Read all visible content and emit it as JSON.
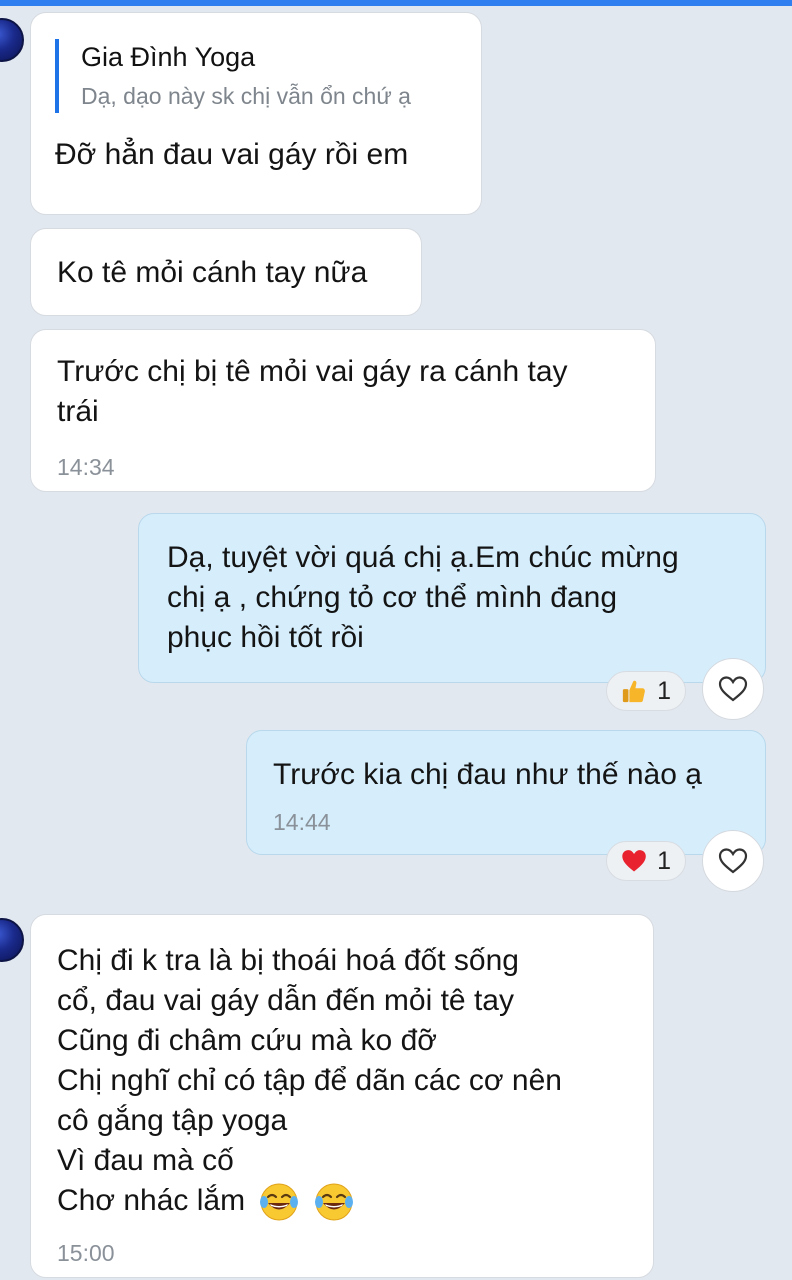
{
  "messages": [
    {
      "id": "m1",
      "direction": "incoming",
      "reply_to": {
        "name": "Gia Đình Yoga",
        "text": "Dạ, dạo này sk chị vẫn ổn chứ ạ"
      },
      "lines": [
        "Đỡ hẳn đau vai gáy rồi em"
      ]
    },
    {
      "id": "m2",
      "direction": "incoming",
      "lines": [
        "Ko tê mỏi cánh tay nữa"
      ]
    },
    {
      "id": "m3",
      "direction": "incoming",
      "lines": [
        "Trước chị bị tê mỏi vai gáy ra cánh tay",
        "trái"
      ],
      "time": "14:34"
    },
    {
      "id": "m4",
      "direction": "outgoing",
      "lines": [
        "Dạ, tuyệt vời quá chị ạ.Em chúc mừng",
        "chị ạ , chứng tỏ cơ thể mình đang",
        "phục hồi tốt rồi"
      ],
      "reaction": {
        "icon": "thumbs-up-icon",
        "count": "1"
      }
    },
    {
      "id": "m5",
      "direction": "outgoing",
      "lines": [
        "Trước kia chị đau như thế nào ạ"
      ],
      "time": "14:44",
      "reaction": {
        "icon": "red-heart-icon",
        "count": "1"
      }
    },
    {
      "id": "m6",
      "direction": "incoming",
      "lines": [
        "Chị đi k tra là bị thoái hoá đốt sống",
        "cổ, đau vai gáy dẫn đến mỏi tê tay",
        "Cũng đi châm cứu mà ko đỡ",
        "Chị nghĩ chỉ có tập để dãn các cơ nên",
        "cô gắng tập yoga",
        "Vì đau mà cố",
        "Chơ nhác lắm"
      ],
      "trailing_emojis": [
        "tears-of-joy-icon",
        "tears-of-joy-icon"
      ],
      "time": "15:00"
    }
  ],
  "colors": {
    "background": "#e2e8ef",
    "incoming_bubble": "#ffffff",
    "outgoing_bubble": "#d6eefc",
    "quote_bar": "#1e73e6",
    "timestamp": "#8a9199"
  }
}
